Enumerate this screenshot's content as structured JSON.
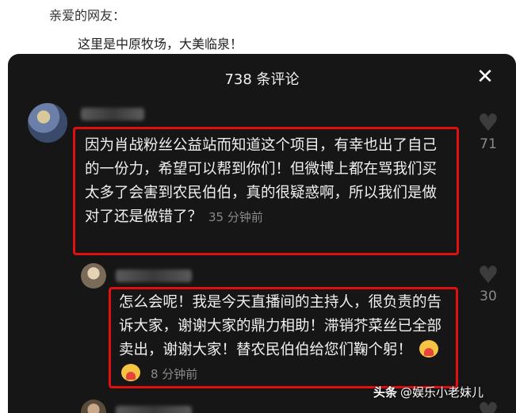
{
  "article": {
    "greeting": "亲爱的网友：",
    "subline": "这里是中原牧场，大美临泉！"
  },
  "comments_panel": {
    "title": "738 条评论",
    "close_icon": "close-icon"
  },
  "comments": [
    {
      "text": "因为肖战粉丝公益站而知道这个项目，有幸也出了自己的一份力，希望可以帮到你们！但微博上都在骂我们买太多了会害到农民伯伯，真的很疑惑啊，所以我们是做对了还是做错了？",
      "time": "35 分钟前",
      "likes": "71"
    },
    {
      "text": "怎么会呢！我是今天直播间的主持人，很负责的告诉大家，谢谢大家的鼎力相助！滞销芥菜丝已全部卖出，谢谢大家！替农民伯伯给您们鞠个躬！",
      "emoji_count": 2,
      "time": "8 分钟前",
      "likes": "30"
    }
  ],
  "watermark": {
    "brand": "头条",
    "account": "@娱乐小老妹儿"
  },
  "colors": {
    "panel_bg": "#161616",
    "highlight_border": "#e01010",
    "muted_text": "#8a8a8a"
  }
}
